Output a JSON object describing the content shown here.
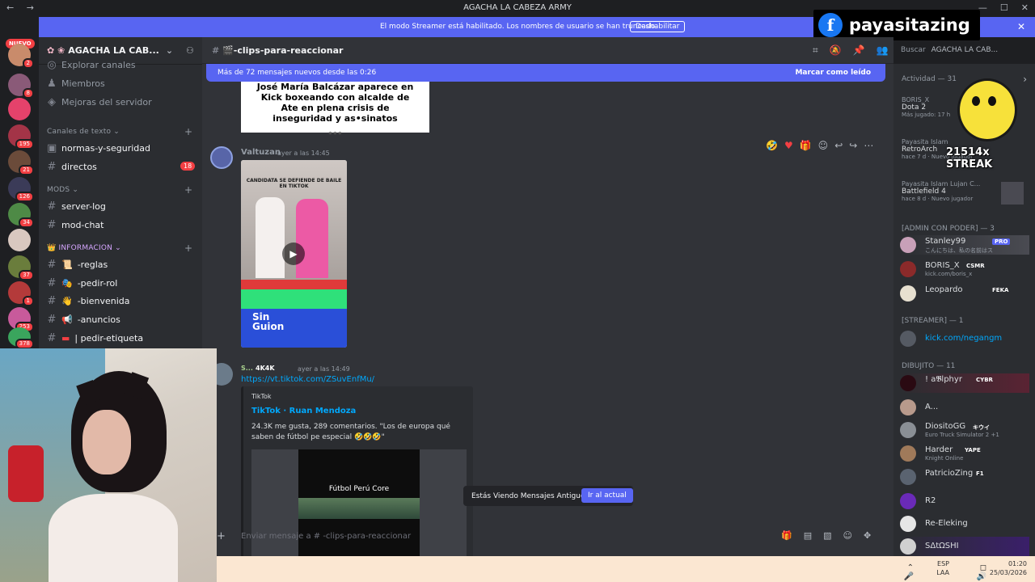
{
  "window": {
    "title": "AGACHA LA CABEZA ARMY"
  },
  "badge_new": "NUEVO",
  "streamer_banner": {
    "text": "El modo Streamer está habilitado. Los nombres de usuario se han truncado.",
    "button": "Deshabilitar"
  },
  "overlay": {
    "facebook_name": "payasitazing",
    "streak": "21514x STREAK"
  },
  "server": {
    "name": "AGACHA LA CAB..."
  },
  "channel_list": {
    "top_items": [
      {
        "label": "Explorar canales"
      },
      {
        "label": "Miembros"
      },
      {
        "label": "Mejoras del servidor"
      }
    ],
    "categories": [
      {
        "name": "Canales de texto",
        "channels": [
          {
            "label": "normas-y-seguridad"
          },
          {
            "label": "directos",
            "badge": "18"
          }
        ]
      },
      {
        "name": "MODS",
        "channels": [
          {
            "label": "server-log"
          },
          {
            "label": "mod-chat"
          }
        ]
      },
      {
        "name": "INFORMACION",
        "channels": [
          {
            "label": "-reglas"
          },
          {
            "label": "-pedir-rol"
          },
          {
            "label": "-bienvenida"
          },
          {
            "label": "-anuncios"
          },
          {
            "label": "| pedir-etiqueta"
          }
        ]
      }
    ]
  },
  "server_badges": [
    "2",
    "8",
    "195",
    "21",
    "126",
    "34",
    "37",
    "1",
    "253",
    "378"
  ],
  "main": {
    "channel_title": "-clips-para-reaccionar",
    "search_placeholder": "Buscar",
    "search_server": "AGACHA LA CAB...",
    "new_messages": "Más de 72 mensajes nuevos desde las 0:26",
    "mark_read": "Marcar como leído",
    "first_embed": {
      "headline": "José María Balcázar aparece en Kick boxeando con alcalde de Ate en plena crisis de inseguridad y as•sinatos"
    },
    "message1": {
      "user": "Valtuzan",
      "time": "ayer a las 14:45",
      "video_title": "CANDIDATA SE DEFIENDE DE BAILE EN TIKTOK",
      "video_footer": "Sin Guion"
    },
    "message2": {
      "user": "S...",
      "tag": "4K4K",
      "time": "ayer a las 14:49",
      "link": "https://vt.tiktok.com/ZSuvEnfMu/",
      "embed_provider": "TikTok",
      "embed_title": "TikTok · Ruan Mendoza",
      "embed_desc": "24.3K me gusta, 289 comentarios. \"Los de europa qué saben de fútbol pe especial 🤣🤣🤣\"",
      "thumb_text": "Fútbol Perú Core"
    },
    "old_messages": "Estás Viendo Mensajes Antiguos",
    "jump_present": "Ir al actual",
    "composer_placeholder": "Enviar mensaje a # -clips-para-reaccionar"
  },
  "members": {
    "activity": "Actividad — 31",
    "activities": [
      {
        "user": "BORIS_X",
        "game": "Dota 2",
        "detail": "Más jugado: 17 h"
      },
      {
        "user": "Payasita Islam",
        "game": "RetroArch",
        "detail": "hace 7 d · Nuevo jugador"
      },
      {
        "user": "Payasita Islam Lujan C...",
        "game": "Battlefield 4",
        "detail": "hace 8 d · Nuevo jugador"
      }
    ],
    "groups": [
      {
        "name": "[ADMIN CON PODER] — 3",
        "members": [
          {
            "name": "Stanley99",
            "tag": "PRO",
            "status": "こんにちは、私の名前はス"
          },
          {
            "name": "BORIS_X",
            "tag": "CSMR",
            "status": "kick.com/boris_x"
          },
          {
            "name": "Leopardo",
            "tag": "FEKA",
            "status": ""
          }
        ]
      },
      {
        "name": "[STREAMER] — 1",
        "members": [
          {
            "name": "kick.com/negangm",
            "tag": "",
            "status": ""
          }
        ]
      },
      {
        "name": "DIBUJITO — 11",
        "members": [
          {
            "name": "! a𝕭lphyr",
            "tag": "CYBR",
            "status": ""
          },
          {
            "name": "A...",
            "tag": "",
            "status": ""
          },
          {
            "name": "DiositoGG",
            "tag": "キウイ",
            "status": "Euro Truck Simulator 2 +1"
          },
          {
            "name": "Harder",
            "tag": "YAPE",
            "status": "Knight Online"
          },
          {
            "name": "PatricioZing",
            "tag": "F1",
            "status": ""
          },
          {
            "name": "R2",
            "tag": "",
            "status": ""
          },
          {
            "name": "Re-Eleking",
            "tag": "",
            "status": ""
          },
          {
            "name": "SΔtΩSHI",
            "tag": "",
            "status": ""
          }
        ]
      }
    ]
  },
  "taskbar": {
    "lang": "ESP",
    "lang2": "LAA",
    "time": "01:20",
    "date": "25/03/2026"
  }
}
